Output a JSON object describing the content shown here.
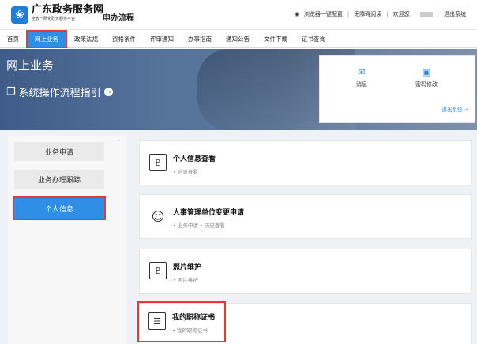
{
  "header": {
    "logo_text": "❀",
    "brand_title": "广东政务服务网",
    "brand_subtitle": "全省一网化政务服务平台",
    "app_name": "申办流程",
    "util": {
      "browser_config": "浏览器一键配置",
      "accessible": "无障碍阅读",
      "welcome": "欢迎您，",
      "logout": "退出系统",
      "separator": "|"
    }
  },
  "nav": {
    "items": [
      "首页",
      "网上业务",
      "政策法规",
      "资格条件",
      "评审通知",
      "办事指南",
      "通知公告",
      "文件下载",
      "证书查询"
    ]
  },
  "banner": {
    "title": "网上业务",
    "guide": "系统操作流程指引",
    "guide_icon": "❐",
    "guide_arrow": "→",
    "quick": {
      "message": "消息",
      "message_icon": "✉",
      "password": "密码修改",
      "password_icon": "▣",
      "logout": "退出系统 →"
    }
  },
  "sidebar": {
    "items": [
      "业务申请",
      "业务办理跟踪",
      "个人信息"
    ],
    "scroll_caret": "^"
  },
  "cards": [
    {
      "title": "个人信息查看",
      "sub": "• 信息查看",
      "icon": "♇"
    },
    {
      "title": "人事管理单位变更申请",
      "sub": "• 业务申请  • 历史查看",
      "icon": "☺"
    },
    {
      "title": "照片维护",
      "sub": "• 照片维护",
      "icon": "♇"
    },
    {
      "title": "我的职称证书",
      "sub": "• 我的职称证书",
      "icon": "☰"
    }
  ]
}
